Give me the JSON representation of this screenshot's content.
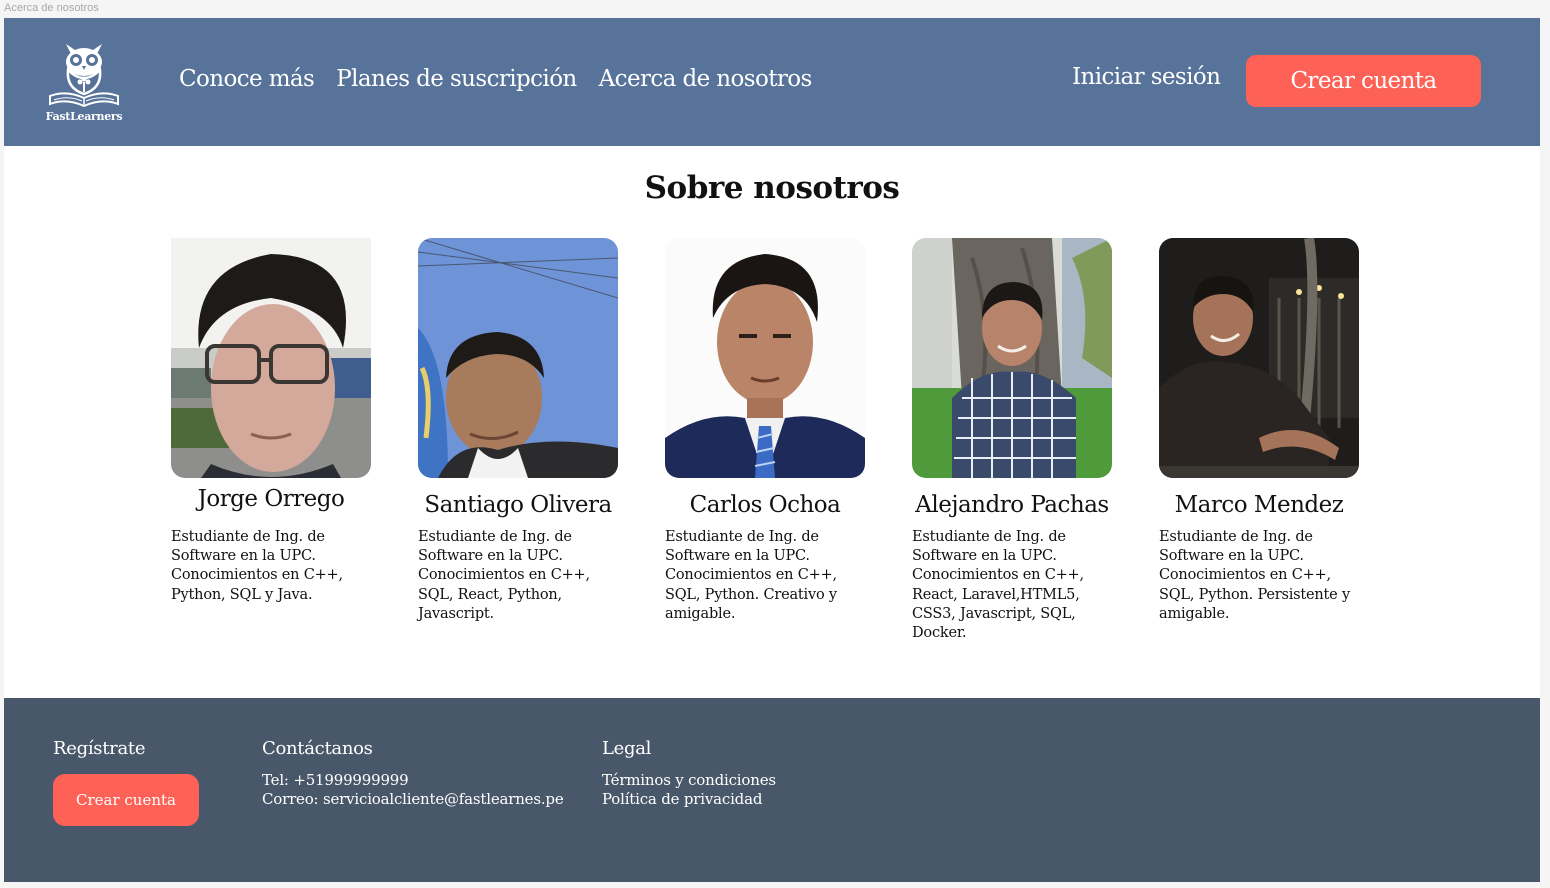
{
  "window": {
    "frame_label": "Acerca de nosotros"
  },
  "brand": {
    "name": "FastLearners"
  },
  "header": {
    "nav": [
      "Conoce más",
      "Planes de suscripción",
      "Acerca de nosotros"
    ],
    "login_label": "Iniciar sesión",
    "cta_label": "Crear cuenta"
  },
  "main": {
    "title": "Sobre nosotros",
    "members": [
      {
        "name": "Jorge Orrego",
        "description": "Estudiante de Ing. de Software en la UPC. Conocimientos en C++, Python, SQL y Java."
      },
      {
        "name": "Santiago Olivera",
        "description": "Estudiante de Ing. de Software en la UPC. Conocimientos en C++, SQL, React, Python, Javascript."
      },
      {
        "name": "Carlos Ochoa",
        "description": "Estudiante de Ing. de Software en la UPC. Conocimientos en C++, SQL, Python. Creativo y amigable."
      },
      {
        "name": "Alejandro Pachas",
        "description": "Estudiante de Ing. de Software en la UPC. Conocimientos en C++, React, Laravel,HTML5, CSS3, Javascript, SQL, Docker."
      },
      {
        "name": "Marco Mendez",
        "description": "Estudiante de Ing. de Software en la UPC. Conocimientos en C++, SQL, Python. Persistente y amigable."
      }
    ]
  },
  "footer": {
    "register": {
      "heading": "Regístrate",
      "cta_label": "Crear cuenta"
    },
    "contact": {
      "heading": "Contáctanos",
      "phone": "Tel: +51999999999",
      "email": "Correo: servicioalcliente@fastlearnes.pe"
    },
    "legal": {
      "heading": "Legal",
      "links": [
        "Términos y condiciones",
        "Política de privacidad"
      ]
    }
  },
  "colors": {
    "header_bg": "#57739a",
    "footer_bg": "#485769",
    "accent": "#fe6257",
    "text": "#111111"
  },
  "icons": {
    "logo": "owl-book-logo-icon"
  }
}
